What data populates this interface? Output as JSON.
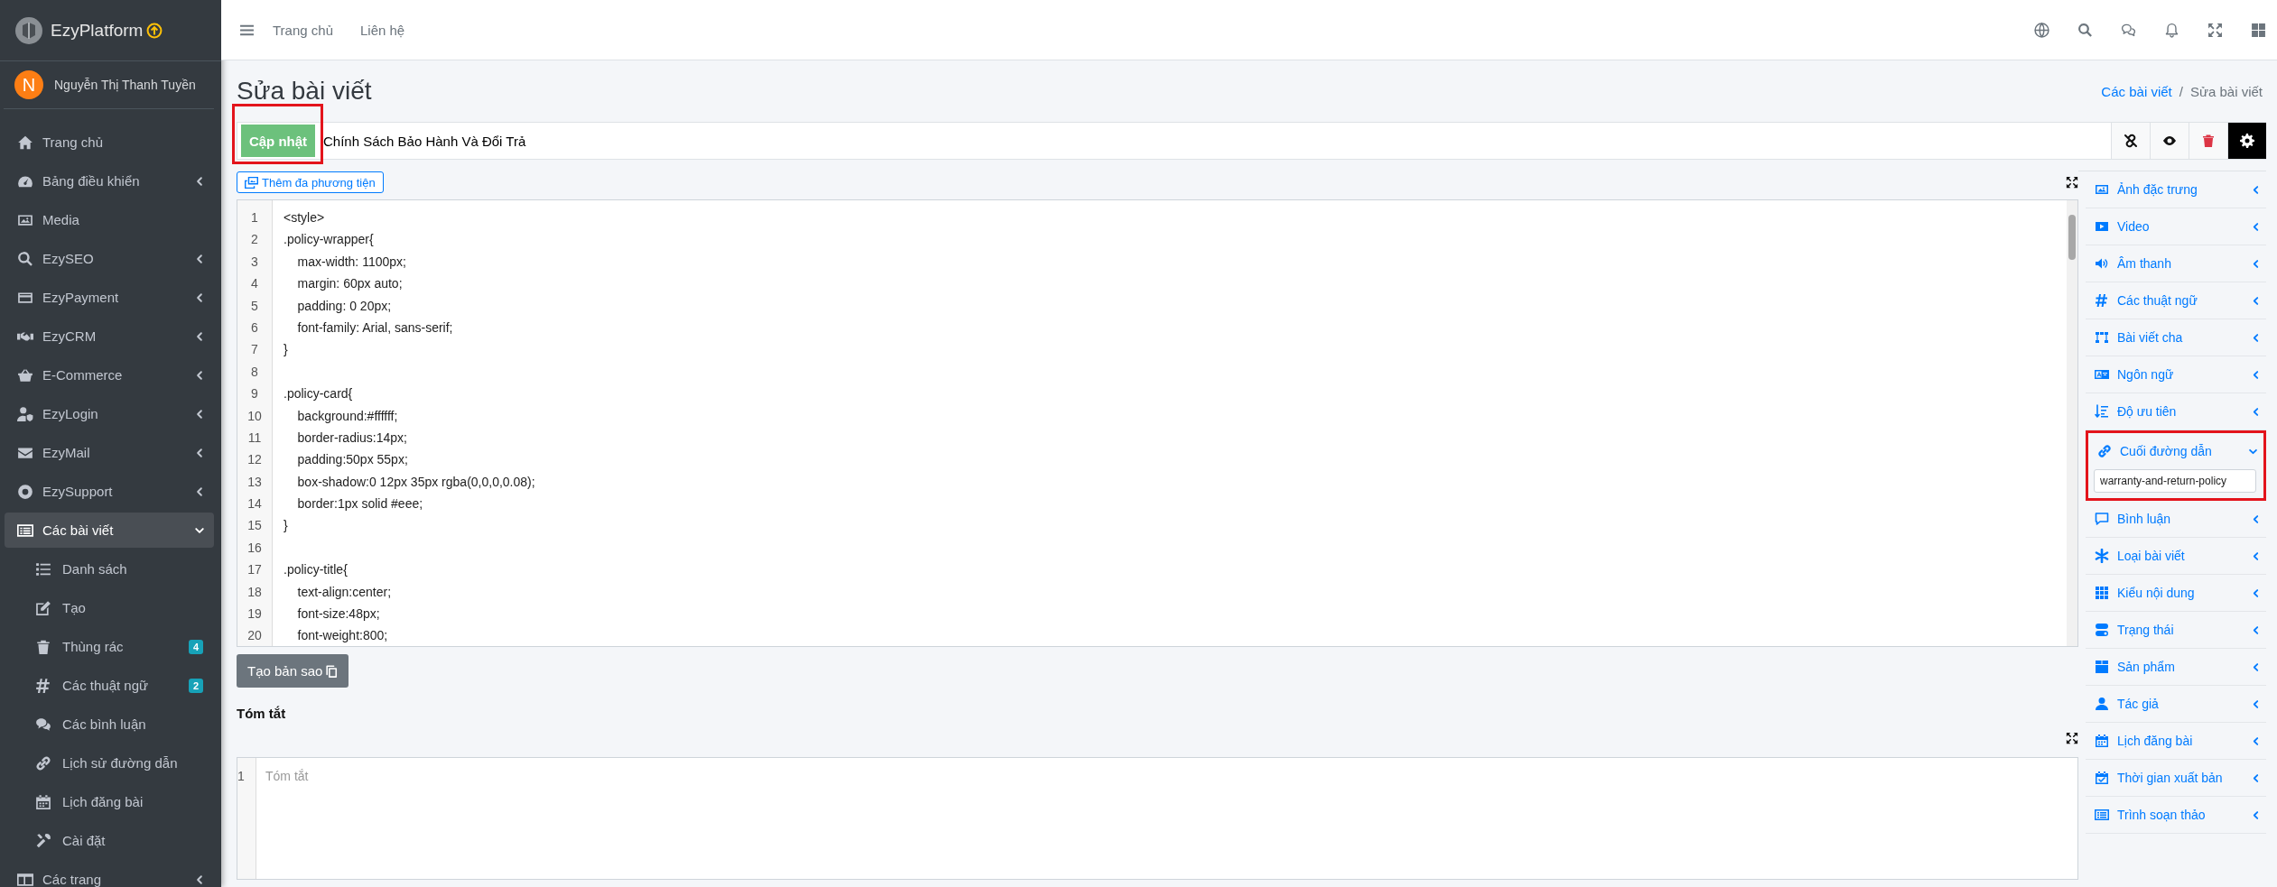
{
  "brand": {
    "name": "EzyPlatform"
  },
  "user": {
    "initial": "N",
    "name": "Nguyễn Thị Thanh Tuyền"
  },
  "sidebar": {
    "items": [
      {
        "label": "Trang chủ",
        "has_submenu": false,
        "selected": false
      },
      {
        "label": "Bảng điều khiển",
        "has_submenu": true,
        "selected": false
      },
      {
        "label": "Media",
        "has_submenu": false,
        "selected": false
      },
      {
        "label": "EzySEO",
        "has_submenu": true,
        "selected": false
      },
      {
        "label": "EzyPayment",
        "has_submenu": true,
        "selected": false
      },
      {
        "label": "EzyCRM",
        "has_submenu": true,
        "selected": false
      },
      {
        "label": "E-Commerce",
        "has_submenu": true,
        "selected": false
      },
      {
        "label": "EzyLogin",
        "has_submenu": true,
        "selected": false
      },
      {
        "label": "EzyMail",
        "has_submenu": true,
        "selected": false
      },
      {
        "label": "EzySupport",
        "has_submenu": true,
        "selected": false
      },
      {
        "label": "Các bài viết",
        "has_submenu": true,
        "selected": true,
        "expanded": true,
        "children": [
          {
            "label": "Danh sách"
          },
          {
            "label": "Tạo"
          },
          {
            "label": "Thùng rác",
            "badge": "4"
          },
          {
            "label": "Các thuật ngữ",
            "badge": "2"
          },
          {
            "label": "Các bình luận"
          },
          {
            "label": "Lịch sử đường dẫn"
          },
          {
            "label": "Lịch đăng bài"
          },
          {
            "label": "Cài đặt"
          }
        ]
      },
      {
        "label": "Các trang",
        "has_submenu": true,
        "selected": false
      }
    ]
  },
  "topnav": {
    "links": [
      "Trang chủ",
      "Liên hệ"
    ]
  },
  "page": {
    "title": "Sửa bài viết",
    "breadcrumb_separator": "/",
    "breadcrumb": [
      {
        "label": "Các bài viết",
        "link": true
      },
      {
        "label": "Sửa bài viết",
        "link": false
      }
    ]
  },
  "editor": {
    "update_button": {
      "label": "Cập nhật",
      "highlighted": true
    },
    "title_value": "Chính Sách Bảo Hành Và Đổi Trả",
    "media_button": "Thêm đa phương tiện",
    "code_lines": [
      {
        "n": "1",
        "text": "<style>"
      },
      {
        "n": "2",
        "text": ".policy-wrapper{"
      },
      {
        "n": "3",
        "text": "    max-width: 1100px;"
      },
      {
        "n": "4",
        "text": "    margin: 60px auto;"
      },
      {
        "n": "5",
        "text": "    padding: 0 20px;"
      },
      {
        "n": "6",
        "text": "    font-family: Arial, sans-serif;"
      },
      {
        "n": "7",
        "text": "}"
      },
      {
        "n": "8"
      },
      {
        "n": "9",
        "text": ".policy-card{"
      },
      {
        "n": "10",
        "text": "    background:#ffffff;"
      },
      {
        "n": "11",
        "text": "    border-radius:14px;"
      },
      {
        "n": "12",
        "text": "    padding:50px 55px;"
      },
      {
        "n": "13",
        "text": "    box-shadow:0 12px 35px rgba(0,0,0,0.08);"
      },
      {
        "n": "14",
        "text": "    border:1px solid #eee;"
      },
      {
        "n": "15",
        "text": "}"
      },
      {
        "n": "16"
      },
      {
        "n": "17",
        "text": ".policy-title{"
      },
      {
        "n": "18",
        "text": "    text-align:center;"
      },
      {
        "n": "19",
        "text": "    font-size:48px;"
      },
      {
        "n": "20",
        "text": "    font-weight:800;"
      }
    ],
    "copy_button": "Tạo bản sao",
    "summary": {
      "label": "Tóm tắt",
      "line_number": "1",
      "placeholder": "Tóm tắt"
    }
  },
  "settings_panel": {
    "sections": [
      {
        "label": "Ảnh đặc trưng",
        "expanded": false
      },
      {
        "label": "Video",
        "expanded": false
      },
      {
        "label": "Âm thanh",
        "expanded": false
      },
      {
        "label": "Các thuật ngữ",
        "expanded": false
      },
      {
        "label": "Bài viết cha",
        "expanded": false
      },
      {
        "label": "Ngôn ngữ",
        "expanded": false
      },
      {
        "label": "Độ ưu tiên",
        "expanded": false
      },
      {
        "label": "Cuối đường dẫn",
        "expanded": true,
        "highlighted": true,
        "value": "warranty-and-return-policy"
      },
      {
        "label": "Bình luận",
        "expanded": false
      },
      {
        "label": "Loại bài viết",
        "expanded": false
      },
      {
        "label": "Kiểu nội dung",
        "expanded": false
      },
      {
        "label": "Trạng thái",
        "expanded": false
      },
      {
        "label": "Sản phẩm",
        "expanded": false
      },
      {
        "label": "Tác giả",
        "expanded": false
      },
      {
        "label": "Lịch đăng bài",
        "expanded": false
      },
      {
        "label": "Thời gian xuất bản",
        "expanded": false
      },
      {
        "label": "Trình soạn thảo",
        "expanded": false
      }
    ]
  }
}
